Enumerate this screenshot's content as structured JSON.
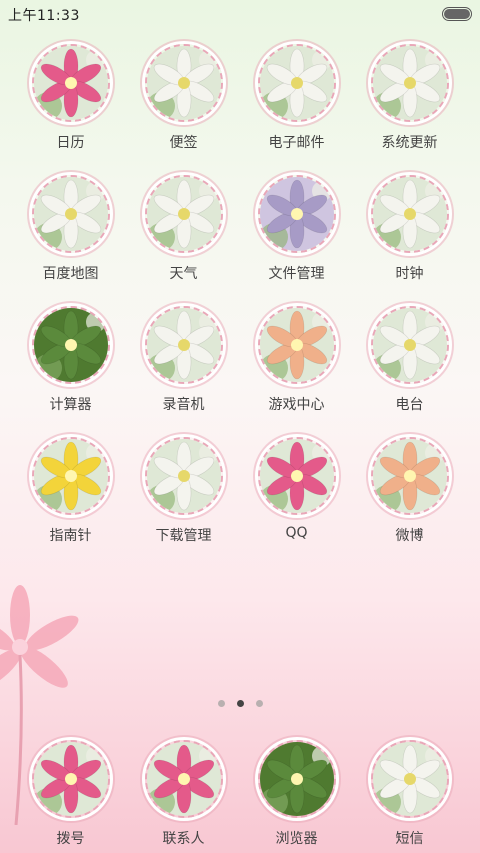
{
  "status_bar": {
    "time": "上午11:33"
  },
  "apps": [
    [
      {
        "label": "日历",
        "icon": "calendar-icon",
        "tone": "pink"
      },
      {
        "label": "便签",
        "icon": "notes-icon",
        "tone": "white"
      },
      {
        "label": "电子邮件",
        "icon": "email-icon",
        "tone": "white"
      },
      {
        "label": "系统更新",
        "icon": "system-update-icon",
        "tone": "white"
      }
    ],
    [
      {
        "label": "百度地图",
        "icon": "baidu-map-icon",
        "tone": "white"
      },
      {
        "label": "天气",
        "icon": "weather-icon",
        "tone": "white"
      },
      {
        "label": "文件管理",
        "icon": "file-manager-icon",
        "tone": "purple"
      },
      {
        "label": "时钟",
        "icon": "clock-icon",
        "tone": "white"
      }
    ],
    [
      {
        "label": "计算器",
        "icon": "calculator-icon",
        "tone": "green"
      },
      {
        "label": "录音机",
        "icon": "recorder-icon",
        "tone": "white"
      },
      {
        "label": "游戏中心",
        "icon": "game-center-icon",
        "tone": "orange"
      },
      {
        "label": "电台",
        "icon": "radio-icon",
        "tone": "white"
      }
    ],
    [
      {
        "label": "指南针",
        "icon": "compass-icon",
        "tone": "yellow"
      },
      {
        "label": "下载管理",
        "icon": "download-manager-icon",
        "tone": "white"
      },
      {
        "label": "QQ",
        "icon": "qq-icon",
        "tone": "pink"
      },
      {
        "label": "微博",
        "icon": "weibo-icon",
        "tone": "orange"
      }
    ]
  ],
  "page_indicator": {
    "count": 3,
    "active": 2
  },
  "dock": [
    {
      "label": "拨号",
      "icon": "dialer-icon",
      "tone": "pink"
    },
    {
      "label": "联系人",
      "icon": "contacts-icon",
      "tone": "pink"
    },
    {
      "label": "浏览器",
      "icon": "browser-icon",
      "tone": "green"
    },
    {
      "label": "短信",
      "icon": "sms-icon",
      "tone": "white"
    }
  ],
  "colors": {
    "pink": "#e45a8a",
    "white": "#f4f4ee",
    "purple": "#a79bc6",
    "green": "#5b8a3c",
    "orange": "#f0b08a",
    "yellow": "#f3d43a",
    "label": "#444444"
  }
}
